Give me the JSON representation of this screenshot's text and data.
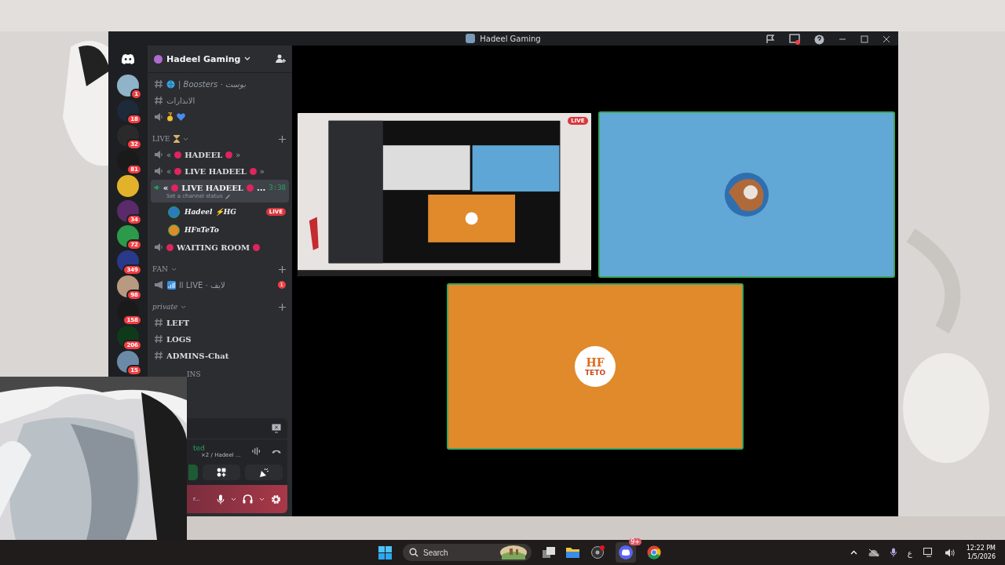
{
  "window": {
    "title": "Hadeel Gaming"
  },
  "servers": [
    {
      "color": "#8fb3c9",
      "badge": "1"
    },
    {
      "color": "#1d2a3a",
      "badge": "18"
    },
    {
      "color": "#2a2a2a",
      "badge": "32"
    },
    {
      "color": "#1a1a1a",
      "badge": "81"
    },
    {
      "color": "#e2b32a"
    },
    {
      "color": "#5a2a6a",
      "badge": "34"
    },
    {
      "color": "#2c9a4a",
      "badge": "72"
    },
    {
      "color": "#2a3a8a",
      "badge": "349"
    },
    {
      "color": "#b89a80",
      "badge": "98"
    },
    {
      "color": "#1a1a1a",
      "badge": "158"
    },
    {
      "color": "#0f3a1a",
      "badge": "206"
    },
    {
      "color": "#6a8aa8",
      "badge": "15"
    }
  ],
  "server_name": "Hadeel Gaming",
  "channels": [
    {
      "kind": "text",
      "name": "| Boosters · بوست",
      "italic": true,
      "selected": false
    },
    {
      "kind": "text",
      "name": "الانذارات",
      "selected": false
    },
    {
      "kind": "voice",
      "selected": false,
      "medal": true
    },
    {
      "kind": "category",
      "name": "LIVE"
    },
    {
      "kind": "voice",
      "pre": "«",
      "name": "HADEEL",
      "post": "»",
      "selected": false
    },
    {
      "kind": "voice",
      "pre": "«",
      "name": "LIVE HADEEL",
      "post": "»",
      "selected": false
    },
    {
      "kind": "voice",
      "pre": "«",
      "name": "LIVE HADEEL",
      "post": "...",
      "selected": true,
      "time": "3:38",
      "status": "Set a channel status"
    },
    {
      "kind": "user",
      "name": "Hadeel ⚡HG",
      "live": "LIVE",
      "color": "#2a7ac0"
    },
    {
      "kind": "user",
      "name": "HF¤TeTo",
      "color": "#e08a2a"
    },
    {
      "kind": "voice",
      "name": "WAITING ROOM",
      "dots": true,
      "selected": false
    },
    {
      "kind": "category",
      "name": "FAN"
    },
    {
      "kind": "announce",
      "name": "ll LIVE · لايف",
      "badge": "1",
      "selected": false
    },
    {
      "kind": "category",
      "name": "private",
      "italic": true
    },
    {
      "kind": "text",
      "name": "LEFT",
      "bold": true,
      "selected": false
    },
    {
      "kind": "text",
      "name": "LOGS",
      "bold": true,
      "selected": false
    },
    {
      "kind": "text",
      "name": "ADMINS-Chat",
      "bold": true,
      "selected": false
    }
  ],
  "hidden_category": "INS",
  "voice_panel": {
    "state": "ted",
    "channel": "×2 / Hadeel ...",
    "user_status": "r..."
  },
  "tiles": [
    {
      "kind": "screen",
      "live": "LIVE",
      "speaking": false
    },
    {
      "kind": "avatar",
      "color": "#62a8d6",
      "speaking": true
    },
    {
      "kind": "logo",
      "color": "#e08a2c",
      "logo_top": "HF",
      "logo_bottom": "TETO",
      "speaking": true
    }
  ],
  "taskbar": {
    "search": {
      "placeholder": "Search"
    },
    "discord_badge": "9+",
    "tray_language": "ع",
    "time": "12:22 PM",
    "date": "1/5/2026"
  }
}
